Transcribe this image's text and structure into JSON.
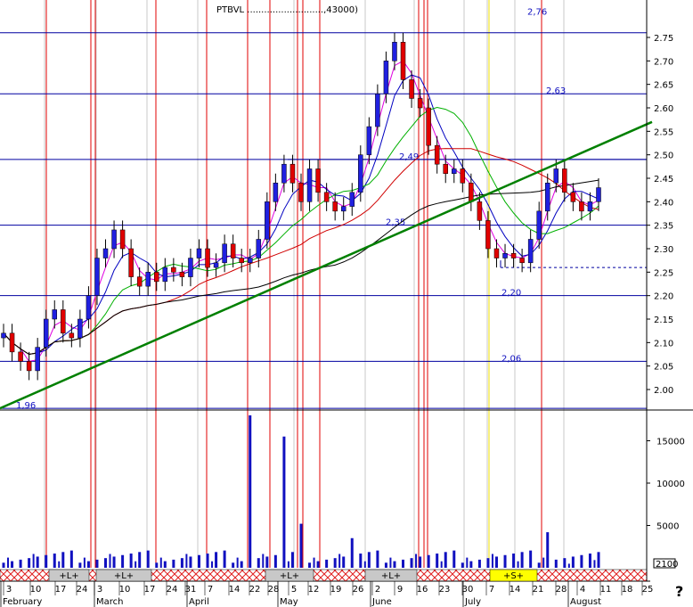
{
  "chart_data": {
    "type": "candlestick",
    "title_overlay": "PTBVL ...........................,43000)",
    "price_axis": {
      "ylim": [
        1.95,
        2.8
      ],
      "ticks": [
        "2.75",
        "2.70",
        "2.65",
        "2.60",
        "2.55",
        "2.50",
        "2.45",
        "2.40",
        "2.35",
        "2.30",
        "2.25",
        "2.20",
        "2.15",
        "2.10",
        "2.05",
        "2.00"
      ]
    },
    "volume_axis": {
      "ylim": [
        0,
        20000
      ],
      "ticks": [
        "15000",
        "10000",
        "5000"
      ]
    },
    "x_day_labels": [
      "3",
      "10",
      "17",
      "24",
      "3",
      "10",
      "17",
      "24",
      "31",
      "7",
      "14",
      "22",
      "28",
      "5",
      "12",
      "19",
      "26",
      "2",
      "9",
      "16",
      "23",
      "30",
      "7",
      "14",
      "21",
      "28",
      "4",
      "11",
      "18",
      "25"
    ],
    "month_labels": [
      "February",
      "March",
      "April",
      "May",
      "June",
      "July",
      "August"
    ],
    "horizontal_levels": [
      {
        "value": 2.76,
        "label": "2,76"
      },
      {
        "value": 2.63,
        "label": "2,63"
      },
      {
        "value": 2.49,
        "label": "2,49"
      },
      {
        "value": 2.35,
        "label": "2,35"
      },
      {
        "value": 2.2,
        "label": "2,20"
      },
      {
        "value": 2.06,
        "label": "2,06"
      },
      {
        "value": 1.96,
        "label": "1,96"
      }
    ],
    "support_dashed": 2.26,
    "trendline": {
      "start": [
        0,
        1.96
      ],
      "end": [
        1,
        2.57
      ]
    },
    "signal_bars": [
      {
        "label": "+L+"
      },
      {
        "label": "+L+"
      },
      {
        "label": "+L+"
      },
      {
        "label": "+L+"
      },
      {
        "label": "+S+"
      }
    ],
    "corner_label": "2100",
    "up_color": "#2020e0",
    "down_color": "#e00000"
  },
  "help_label": "?"
}
